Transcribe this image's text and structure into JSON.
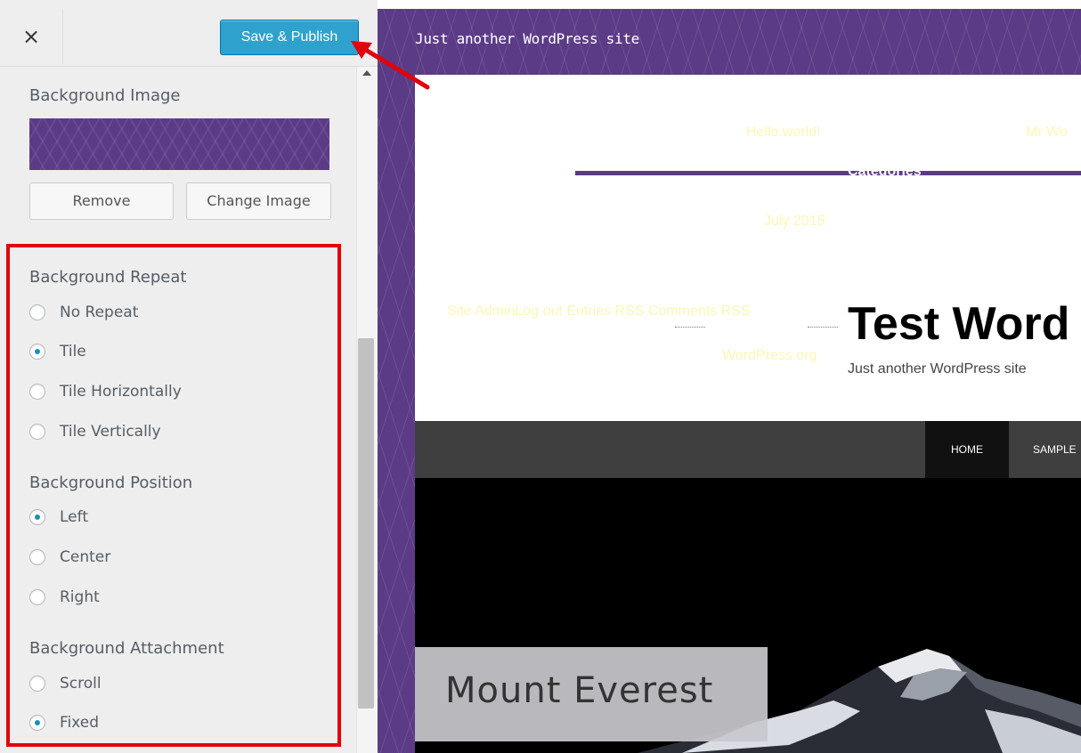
{
  "topbar": {
    "close_icon": "×",
    "save_label": "Save & Publish"
  },
  "panel": {
    "bg_image_title": "Background Image",
    "remove_label": "Remove",
    "change_label": "Change Image",
    "repeat": {
      "title": "Background Repeat",
      "options": [
        {
          "label": "No Repeat",
          "checked": false
        },
        {
          "label": "Tile",
          "checked": true
        },
        {
          "label": "Tile Horizontally",
          "checked": false
        },
        {
          "label": "Tile Vertically",
          "checked": false
        }
      ]
    },
    "position": {
      "title": "Background Position",
      "options": [
        {
          "label": "Left",
          "checked": true
        },
        {
          "label": "Center",
          "checked": false
        },
        {
          "label": "Right",
          "checked": false
        }
      ]
    },
    "attachment": {
      "title": "Background Attachment",
      "options": [
        {
          "label": "Scroll",
          "checked": false
        },
        {
          "label": "Fixed",
          "checked": true
        }
      ]
    }
  },
  "preview": {
    "tagline": "Just another WordPress site",
    "hello_world": "Hello world!",
    "mr_wo": "Mr Wo",
    "categories": "Categories",
    "july": "July 2015",
    "meta_links": "Site AdminLog out Entries RSS Comments RSS",
    "wordpress_org": "WordPress.org",
    "site_title": "Test Word",
    "site_description": "Just another WordPress site",
    "nav": {
      "home": "HOME",
      "sample": "SAMPLE"
    },
    "hero_caption": "Mount Everest"
  },
  "colors": {
    "accent": "#2ea2cc",
    "background_purple": "#5b3b86",
    "highlight_red": "#e2000b"
  }
}
